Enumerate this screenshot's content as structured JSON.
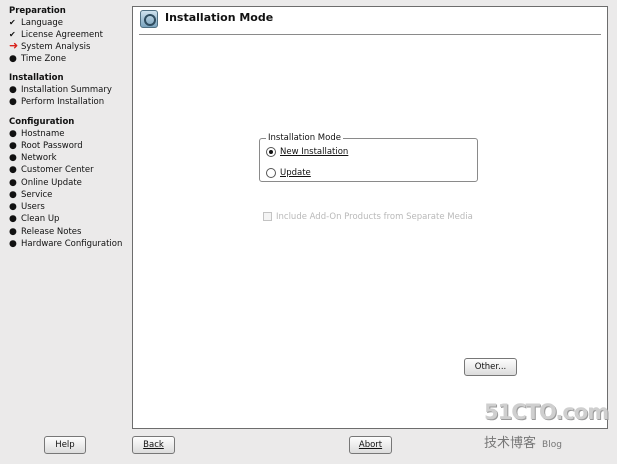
{
  "sidebar": {
    "sections": [
      {
        "title": "Preparation",
        "items": [
          {
            "label": "Language",
            "marker": "✔"
          },
          {
            "label": "License Agreement",
            "marker": "✔"
          },
          {
            "label": "System Analysis",
            "marker": "➜"
          },
          {
            "label": "Time Zone",
            "marker": "●"
          }
        ]
      },
      {
        "title": "Installation",
        "items": [
          {
            "label": "Installation Summary",
            "marker": "●"
          },
          {
            "label": "Perform Installation",
            "marker": "●"
          }
        ]
      },
      {
        "title": "Configuration",
        "items": [
          {
            "label": "Hostname",
            "marker": "●"
          },
          {
            "label": "Root Password",
            "marker": "●"
          },
          {
            "label": "Network",
            "marker": "●"
          },
          {
            "label": "Customer Center",
            "marker": "●"
          },
          {
            "label": "Online Update",
            "marker": "●"
          },
          {
            "label": "Service",
            "marker": "●"
          },
          {
            "label": "Users",
            "marker": "●"
          },
          {
            "label": "Clean Up",
            "marker": "●"
          },
          {
            "label": "Release Notes",
            "marker": "●"
          },
          {
            "label": "Hardware Configuration",
            "marker": "●"
          }
        ]
      }
    ]
  },
  "main": {
    "title": "Installation Mode",
    "group_label": "Installation Mode",
    "options": [
      {
        "label": "New Installation",
        "selected": true
      },
      {
        "label": "Update",
        "selected": false
      }
    ],
    "addon_label": "Include Add-On Products from Separate Media",
    "other_button": "Other..."
  },
  "footer": {
    "help": "Help",
    "back": "Back",
    "abort": "Abort"
  },
  "watermark": {
    "top": "51CTO.com",
    "bottom": "技术博客",
    "blog": "Blog"
  },
  "colors": {
    "current_step_arrow": "#d8231c",
    "background": "#ebeaea",
    "panel": "#ffffff"
  }
}
